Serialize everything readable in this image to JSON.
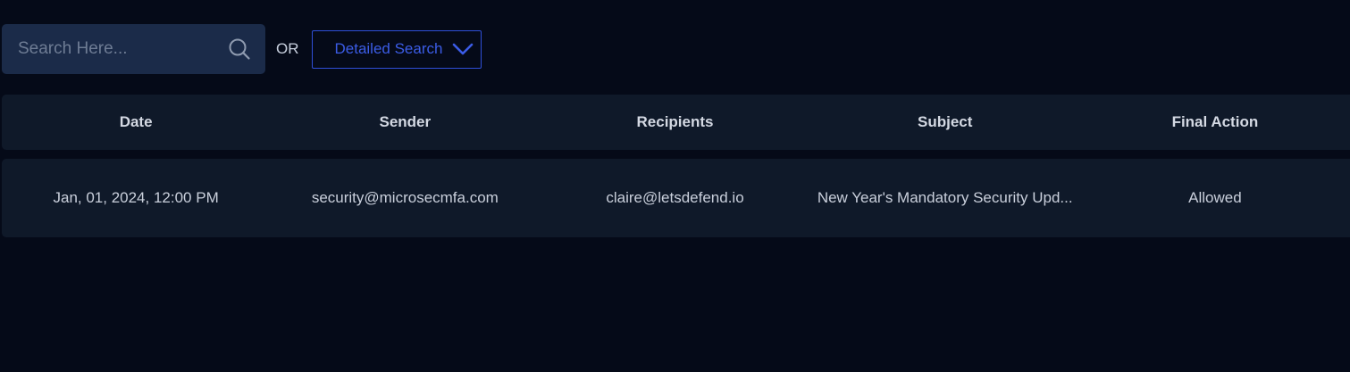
{
  "search": {
    "placeholder": "Search Here...",
    "value": "",
    "icon": "search-icon"
  },
  "or_label": "OR",
  "detailed_search": {
    "label": "Detailed Search",
    "icon": "chevron-down-icon",
    "accent_color": "#3b5ce6"
  },
  "table": {
    "columns": [
      "Date",
      "Sender",
      "Recipients",
      "Subject",
      "Final Action"
    ],
    "rows": [
      {
        "date": "Jan, 01, 2024, 12:00 PM",
        "sender": "security@microsecmfa.com",
        "recipients": "claire@letsdefend.io",
        "subject": "New Year's Mandatory Security Upd...",
        "final_action": "Allowed"
      }
    ]
  },
  "colors": {
    "background": "#050a18",
    "panel": "#0f1929",
    "search_bg": "#1b2b49"
  }
}
